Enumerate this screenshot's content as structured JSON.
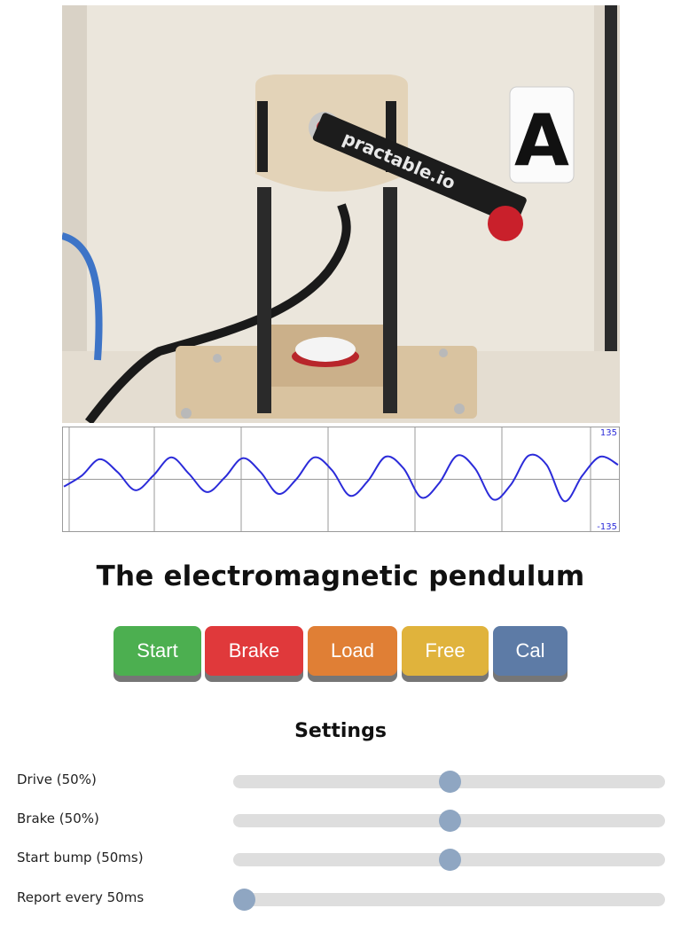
{
  "camera": {
    "sign_letter": "A",
    "arm_text": "practable.io"
  },
  "chart": {
    "y_max_label": "135",
    "y_min_label": "-135"
  },
  "chart_data": {
    "type": "line",
    "ylim": [
      -135,
      135
    ],
    "grid": true,
    "series": [
      {
        "values": [
          -20,
          10,
          55,
          20,
          -30,
          10,
          60,
          15,
          -35,
          5,
          58,
          20,
          -40,
          0,
          60,
          25,
          -45,
          -5,
          62,
          30,
          -50,
          -10,
          65,
          30,
          -55,
          -15,
          65,
          40,
          -60,
          10,
          62,
          40
        ]
      }
    ],
    "colors": {
      "line": "#2b2bd9",
      "grid": "#9a9a9a"
    }
  },
  "title": "The electromagnetic pendulum",
  "buttons": {
    "start": "Start",
    "brake": "Brake",
    "load": "Load",
    "free": "Free",
    "cal": "Cal"
  },
  "settings": {
    "heading": "Settings",
    "drive": {
      "label": "Drive (50%)",
      "value": 0.5
    },
    "brake": {
      "label": "Brake (50%)",
      "value": 0.5
    },
    "start_bump": {
      "label": "Start bump (50ms)",
      "value": 0.5
    },
    "report": {
      "label": "Report every 50ms",
      "value": 0.025
    }
  }
}
